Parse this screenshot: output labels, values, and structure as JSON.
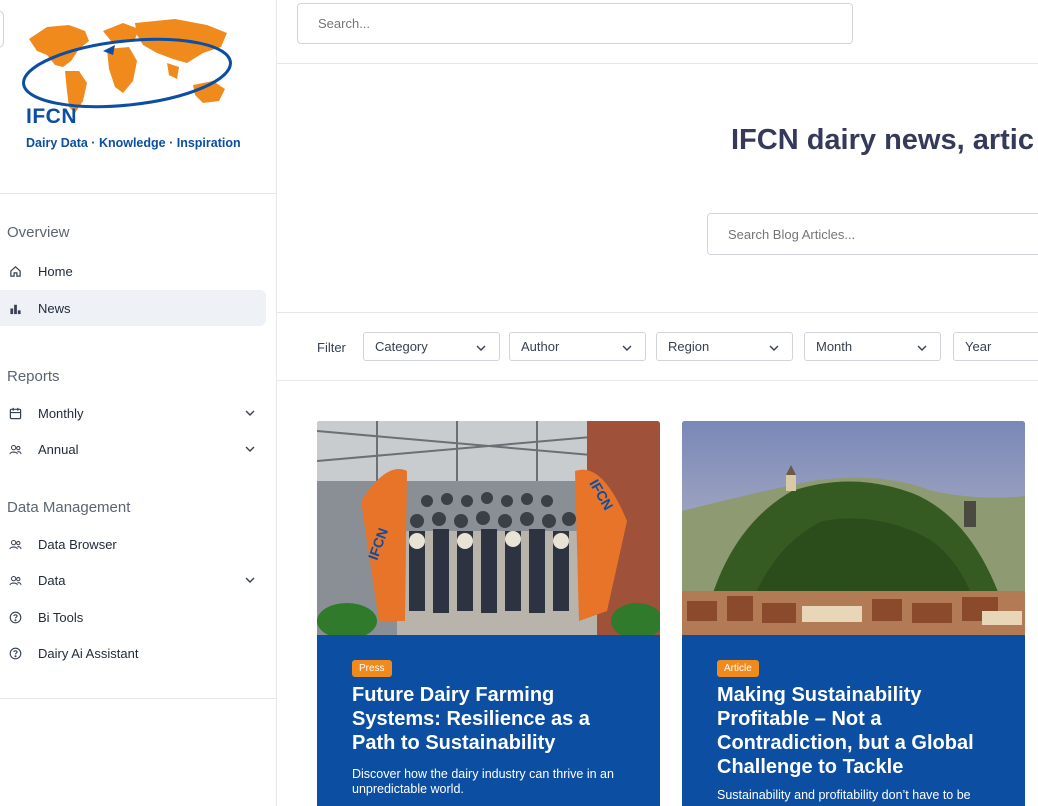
{
  "search": {
    "placeholder": "Search..."
  },
  "logo": {
    "name": "IFCN",
    "tagline": "Dairy Data · Knowledge · Inspiration"
  },
  "sidebar": {
    "overview_title": "Overview",
    "overview_items": [
      {
        "label": "Home",
        "icon": "home-icon"
      },
      {
        "label": "News",
        "icon": "bar-chart-icon",
        "active": true
      }
    ],
    "reports_title": "Reports",
    "reports_items": [
      {
        "label": "Monthly",
        "icon": "calendar-icon",
        "has_submenu": true
      },
      {
        "label": "Annual",
        "icon": "users-icon",
        "has_submenu": true
      }
    ],
    "data_title": "Data Management",
    "data_items": [
      {
        "label": "Data Browser",
        "icon": "users-icon"
      },
      {
        "label": "Data",
        "icon": "users-icon",
        "has_submenu": true
      },
      {
        "label": "Bi Tools",
        "icon": "help-circle-icon"
      },
      {
        "label": "Dairy Ai Assistant",
        "icon": "help-circle-icon"
      }
    ]
  },
  "hero": {
    "title": "IFCN dairy news, artic",
    "search_placeholder": "Search Blog Articles..."
  },
  "filters": {
    "label": "Filter",
    "selects": [
      "Category",
      "Author",
      "Region",
      "Month",
      "Year"
    ]
  },
  "cards": [
    {
      "badge": "Press",
      "title": "Future Dairy Farming Systems: Resilience as a Path to Sustainability",
      "description": "Discover how the dairy industry can thrive in an unpredictable world."
    },
    {
      "badge": "Article",
      "title": "Making Sustainability Profitable – Not a Contradiction, but a Global Challenge to Tackle",
      "description": "Sustainability and profitability don’t have to be"
    }
  ],
  "colors": {
    "brand_blue": "#0b4ea2",
    "brand_orange": "#f08a1c",
    "active_bg": "#eef1f6"
  }
}
